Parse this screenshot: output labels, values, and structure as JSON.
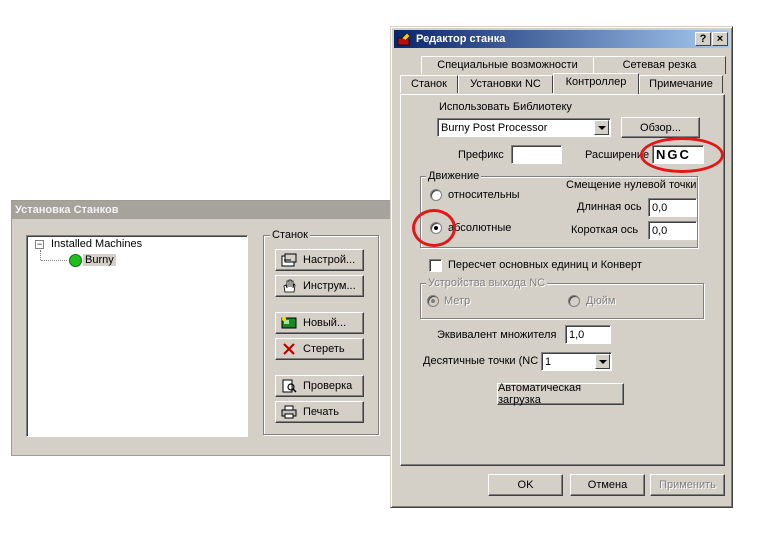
{
  "machine_setup": {
    "title": "Установка Станков",
    "tree": {
      "root": "Installed Machines",
      "expander": "−",
      "child": "Burny"
    },
    "group_label": "Станок",
    "buttons": {
      "setup": "Настрой...",
      "tools": "Инструм...",
      "new": "Новый...",
      "delete": "Стереть",
      "check": "Проверка",
      "print": "Печать"
    }
  },
  "editor": {
    "title": "Редактор станка",
    "help_btn": "?",
    "close_btn": "×",
    "tabs_back": [
      "Специальные возможности",
      "Сетевая резка"
    ],
    "tabs_front": [
      "Станок",
      "Установки NC",
      "Контроллер",
      "Примечание"
    ],
    "use_library_label": "Использовать Библиотеку",
    "library_value": "Burny Post Processor",
    "browse": "Обзор...",
    "prefix_label": "Префикс",
    "prefix_value": "",
    "extension_label": "Расширение",
    "extension_value": "NGC",
    "movement": {
      "label": "Движение",
      "relative": "относительны",
      "absolute": "абсолютные",
      "zero_offset_label": "Смещение нулевой точки",
      "long_axis_label": "Длинная ось",
      "long_axis_value": "0,0",
      "short_axis_label": "Короткая ось",
      "short_axis_value": "0,0"
    },
    "recalc_label": "Пересчет основных единиц и Конверт",
    "nc_output": {
      "label": "Устройства выхода NC",
      "metric": "Метр",
      "inch": "Дюйм"
    },
    "multiplier_label": "Эквивалент множителя",
    "multiplier_value": "1,0",
    "decimals_label": "Десятичные точки (NC",
    "decimals_value": "1",
    "autoload": "Автоматическая загрузка",
    "ok": "OK",
    "cancel": "Отмена",
    "apply": "Применить"
  }
}
